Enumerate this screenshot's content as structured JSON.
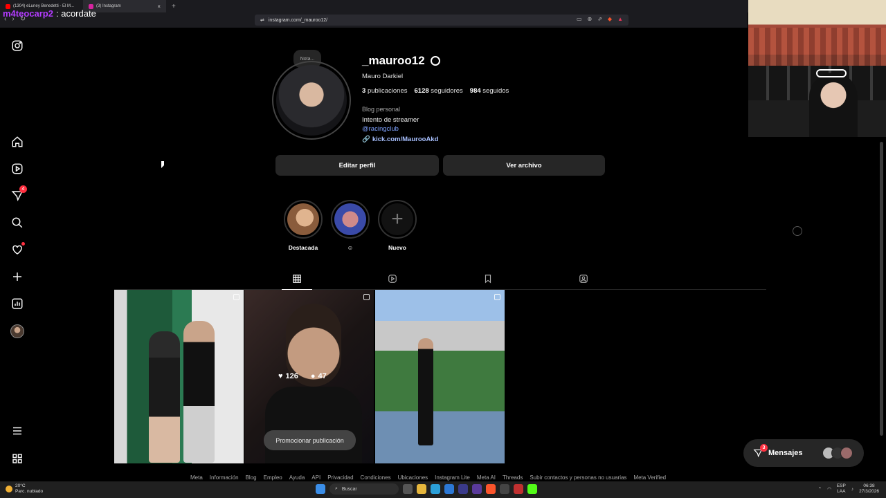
{
  "browser": {
    "tabs": [
      {
        "label": "(1304) eLuney Benedetti - El M...",
        "active": false,
        "color": "#ff0000"
      },
      {
        "label": "(3) Instagram",
        "active": true,
        "color": "#d6249f"
      }
    ],
    "new_tab": "+",
    "url": "instagram.com/_mauroo12/",
    "overlay_user": "m4teocarp2",
    "overlay_text": ": acordate"
  },
  "profile": {
    "note": "Nota...",
    "username": "_mauroo12",
    "full_name": "Mauro Darkiel",
    "posts_count": "3",
    "posts_label": "publicaciones",
    "followers_count": "6128",
    "followers_label": "seguidores",
    "following_count": "984",
    "following_label": "seguidos",
    "category": "Blog personal",
    "bio": "Intento de streamer",
    "mention": "@racingclub",
    "link": "kick.com/MaurooAkd",
    "edit_button": "Editar perfil",
    "archive_button": "Ver archivo"
  },
  "sidenav": {
    "notifications_badge": "4"
  },
  "highlights": [
    {
      "label": "Destacada"
    },
    {
      "label": "☺"
    },
    {
      "label": "Nuevo"
    }
  ],
  "posts": {
    "likes": "126",
    "comments": "47",
    "promote": "Promocionar publicación"
  },
  "footer": [
    "Meta",
    "Información",
    "Blog",
    "Empleo",
    "Ayuda",
    "API",
    "Privacidad",
    "Condiciones",
    "Ubicaciones",
    "Instagram Lite",
    "Meta AI",
    "Threads",
    "Subir contactos y personas no usuarias",
    "Meta Verified"
  ],
  "messages": {
    "label": "Mensajes",
    "badge": "3"
  },
  "taskbar": {
    "temp": "20°C",
    "weather": "Parc. nublado",
    "search": "Buscar",
    "lang1": "ESP",
    "lang2": "LAA",
    "time": "06:38",
    "date": "27/3/2026"
  },
  "colors": {
    "accent_link": "#7fa2ff",
    "badge": "#ff3040",
    "background": "#000000"
  }
}
